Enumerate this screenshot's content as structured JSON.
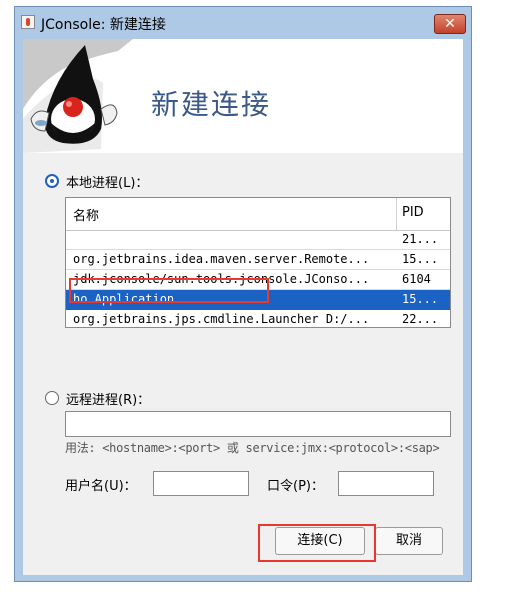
{
  "window": {
    "title": "JConsole: 新建连接",
    "close_glyph": "✕"
  },
  "banner": {
    "title": "新建连接"
  },
  "local": {
    "label": "本地进程(L)：",
    "selected": true,
    "columns": [
      "名称",
      "PID"
    ],
    "rows": [
      {
        "name": "",
        "pid": "21..."
      },
      {
        "name": "org.jetbrains.idea.maven.server.Remote...",
        "pid": "15..."
      },
      {
        "name": "jdk.jconsole/sun.tools.jconsole.JConso...",
        "pid": "6104"
      },
      {
        "name": "ho.Application",
        "pid": "15..."
      },
      {
        "name": "org.jetbrains.jps.cmdline.Launcher D:/...",
        "pid": "22..."
      }
    ],
    "selected_row": 3
  },
  "remote": {
    "label": "远程进程(R)：",
    "selected": false,
    "value": "",
    "usage": "用法: <hostname>:<port> 或 service:jmx:<protocol>:<sap>"
  },
  "credentials": {
    "username_label": "用户名(U)：",
    "username_value": "",
    "password_label": "口令(P)：",
    "password_value": ""
  },
  "buttons": {
    "connect": "连接(C)",
    "cancel": "取消"
  },
  "colors": {
    "selection": "#1a63c4",
    "highlight": "#e8382f",
    "banner_text": "#3b5a87"
  }
}
